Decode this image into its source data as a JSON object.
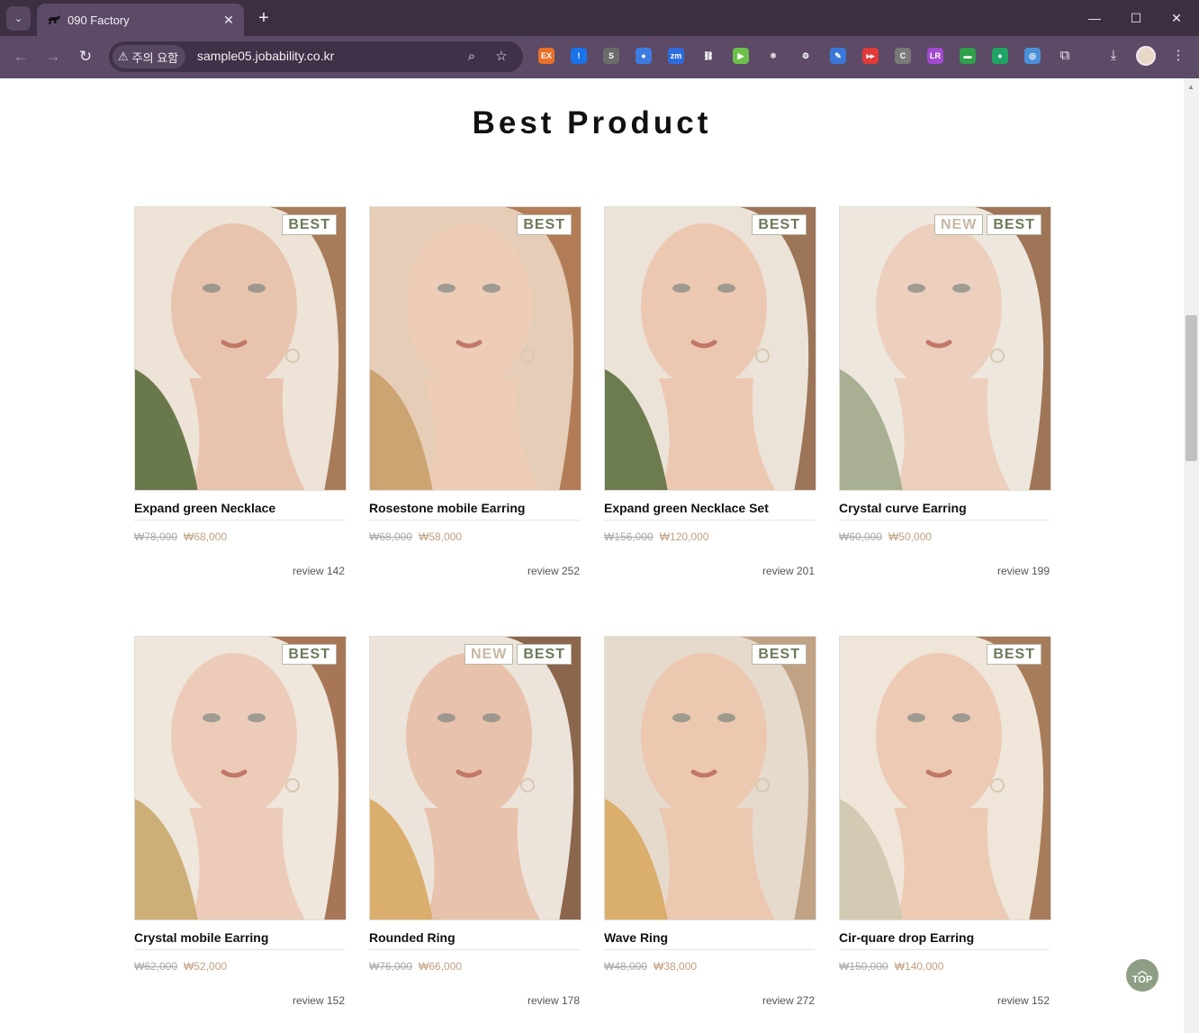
{
  "browser": {
    "tab_title": "090 Factory",
    "tab_close": "✕",
    "new_tab": "+",
    "security_label": "주의 요함",
    "url": "sample05.jobability.co.kr",
    "minimize": "—",
    "maximize": "☐",
    "close": "✕"
  },
  "extensions": [
    {
      "name": "ex-extension-icon",
      "label": "EX",
      "color": "#e8702a"
    },
    {
      "name": "info-extension-icon",
      "label": "!",
      "color": "#1a73e8"
    },
    {
      "name": "s-extension-icon",
      "label": "S",
      "color": "#6b6b6b"
    },
    {
      "name": "drop-extension-icon",
      "label": "●",
      "color": "#3d7be0"
    },
    {
      "name": "zoom-extension-icon",
      "label": "zm",
      "color": "#2d6cdf"
    },
    {
      "name": "link-extension-icon",
      "label": "⛓",
      "color": "#5c4a66"
    },
    {
      "name": "play-extension-icon",
      "label": "▶",
      "color": "#6cc04a"
    },
    {
      "name": "react-extension-icon",
      "label": "⚛",
      "color": "#5c4a66"
    },
    {
      "name": "gear-extension-icon",
      "label": "⚙",
      "color": "#5c4a66"
    },
    {
      "name": "pen-extension-icon",
      "label": "✎",
      "color": "#3a78d8"
    },
    {
      "name": "video-extension-icon",
      "label": "▸▸",
      "color": "#e03a3a"
    },
    {
      "name": "c-extension-icon",
      "label": "C",
      "color": "#7a7a7a"
    },
    {
      "name": "lr-extension-icon",
      "label": "LR",
      "color": "#a24ad0"
    },
    {
      "name": "card-extension-icon",
      "label": "▬",
      "color": "#2ea04a"
    },
    {
      "name": "chat-extension-icon",
      "label": "●",
      "color": "#1fa463"
    },
    {
      "name": "fingerprint-extension-icon",
      "label": "◎",
      "color": "#4a8fd8"
    }
  ],
  "section": {
    "title": "Best Product"
  },
  "products": [
    {
      "name": "Expand green Necklace",
      "old_price": "₩78,000",
      "price": "₩68,000",
      "review": "review 142",
      "badges": [
        "BEST"
      ],
      "palette": {
        "bg": "#ede3d6",
        "skin": "#e8c4ae",
        "hair": "#9a6a44",
        "accent": "#5b6d3c"
      }
    },
    {
      "name": "Rosestone mobile Earring",
      "old_price": "₩68,000",
      "price": "₩58,000",
      "review": "review 252",
      "badges": [
        "BEST"
      ],
      "palette": {
        "bg": "#e6cdb8",
        "skin": "#eecdb8",
        "hair": "#a86e44",
        "accent": "#c9a06a"
      }
    },
    {
      "name": "Expand green Necklace Set",
      "old_price": "₩156,000",
      "price": "₩120,000",
      "review": "review 201",
      "badges": [
        "BEST"
      ],
      "palette": {
        "bg": "#ece3d8",
        "skin": "#ecc8b2",
        "hair": "#8e6242",
        "accent": "#5e7040"
      }
    },
    {
      "name": "Crystal curve Earring",
      "old_price": "₩60,000",
      "price": "₩50,000",
      "review": "review 199",
      "badges": [
        "NEW",
        "BEST"
      ],
      "palette": {
        "bg": "#eee7dd",
        "skin": "#edcfbe",
        "hair": "#8f6040",
        "accent": "#a0a88a"
      }
    },
    {
      "name": "Crystal mobile Earring",
      "old_price": "₩62,000",
      "price": "₩52,000",
      "review": "review 152",
      "badges": [
        "BEST"
      ],
      "palette": {
        "bg": "#efe6dc",
        "skin": "#ecccb8",
        "hair": "#9a6240",
        "accent": "#c8a86c"
      }
    },
    {
      "name": "Rounded Ring",
      "old_price": "₩76,000",
      "price": "₩66,000",
      "review": "review 178",
      "badges": [
        "NEW",
        "BEST"
      ],
      "palette": {
        "bg": "#ece4da",
        "skin": "#e8c2ac",
        "hair": "#7a5034",
        "accent": "#d8a860"
      }
    },
    {
      "name": "Wave Ring",
      "old_price": "₩48,000",
      "price": "₩38,000",
      "review": "review 272",
      "badges": [
        "BEST"
      ],
      "palette": {
        "bg": "#e6dacd",
        "skin": "#ecc8b0",
        "hair": "#b89878",
        "accent": "#d8a860"
      }
    },
    {
      "name": "Cir-quare drop Earring",
      "old_price": "₩150,000",
      "price": "₩140,000",
      "review": "review 152",
      "badges": [
        "BEST"
      ],
      "palette": {
        "bg": "#efe5d8",
        "skin": "#eccab4",
        "hair": "#9a6a44",
        "accent": "#cfc6b0"
      }
    }
  ],
  "top_button": {
    "label": "TOP"
  }
}
